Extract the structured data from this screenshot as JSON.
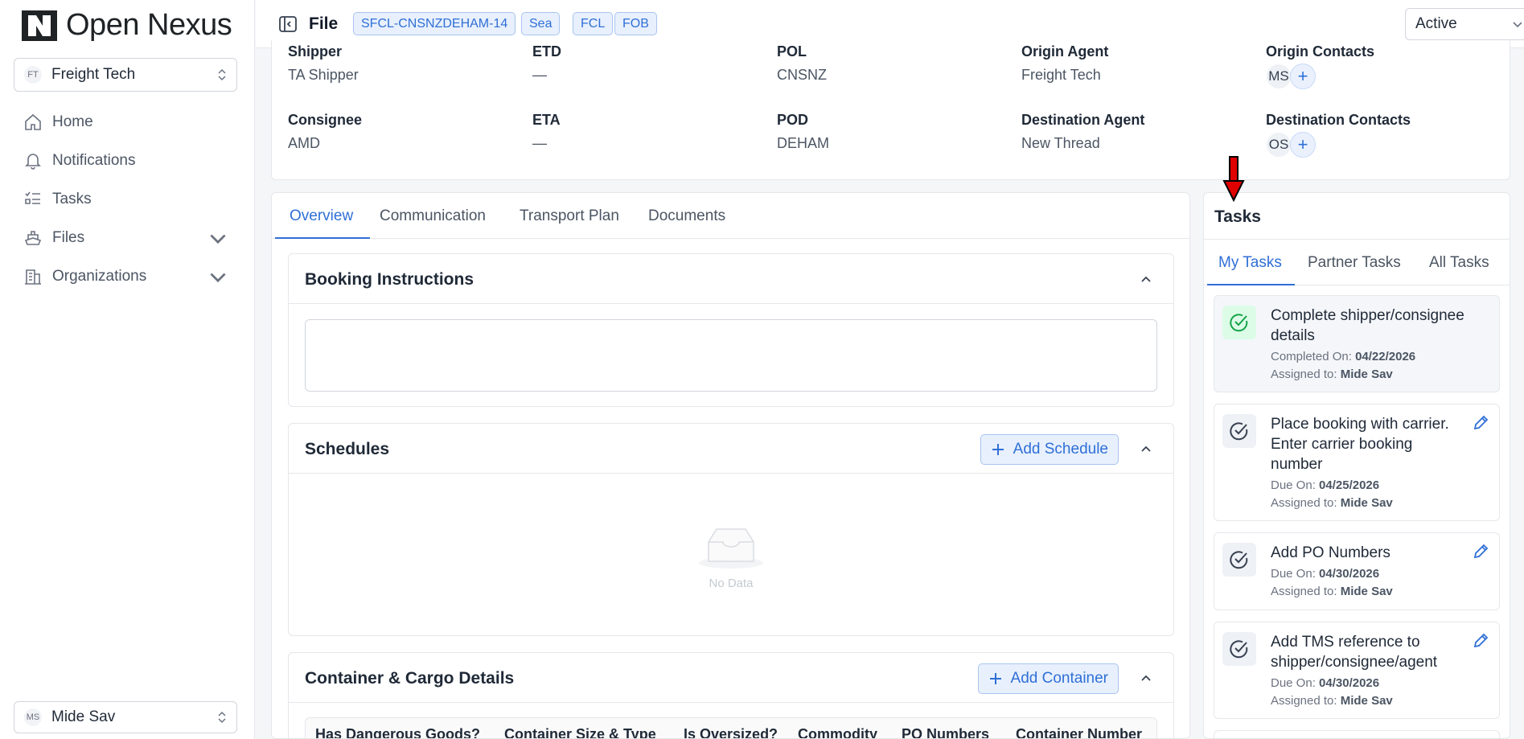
{
  "app": {
    "brand": "Open Nexus"
  },
  "sidebar": {
    "org": {
      "initials": "FT",
      "name": "Freight Tech"
    },
    "items": [
      {
        "label": "Home",
        "icon": "home-icon"
      },
      {
        "label": "Notifications",
        "icon": "bell-icon"
      },
      {
        "label": "Tasks",
        "icon": "tasks-icon"
      },
      {
        "label": "Files",
        "icon": "ship-icon",
        "expandable": true
      },
      {
        "label": "Organizations",
        "icon": "building-icon",
        "expandable": true
      }
    ],
    "user": {
      "initials": "MS",
      "name": "Mide Sav"
    }
  },
  "header": {
    "title": "File",
    "tags": [
      "SFCL-CNSNZDEHAM-14",
      "Sea",
      "FCL",
      "FOB"
    ],
    "status": "Active"
  },
  "summary": {
    "shipper": {
      "label": "Shipper",
      "value": "TA Shipper"
    },
    "etd": {
      "label": "ETD",
      "value": "—"
    },
    "pol": {
      "label": "POL",
      "value": "CNSNZ"
    },
    "origin_agent": {
      "label": "Origin Agent",
      "value": "Freight Tech"
    },
    "origin_contacts": {
      "label": "Origin Contacts",
      "initials": "MS",
      "add": "+"
    },
    "consignee": {
      "label": "Consignee",
      "value": "AMD"
    },
    "eta": {
      "label": "ETA",
      "value": "—"
    },
    "pod": {
      "label": "POD",
      "value": "DEHAM"
    },
    "destination_agent": {
      "label": "Destination Agent",
      "value": "New Thread"
    },
    "destination_contacts": {
      "label": "Destination Contacts",
      "initials": "OS",
      "add": "+"
    }
  },
  "main": {
    "tabs": [
      "Overview",
      "Communication",
      "Transport Plan",
      "Documents"
    ],
    "active_tab": "Overview",
    "booking": {
      "title": "Booking Instructions",
      "value": ""
    },
    "schedules": {
      "title": "Schedules",
      "add_label": "Add Schedule",
      "empty_text": "No Data"
    },
    "containers": {
      "title": "Container & Cargo Details",
      "add_label": "Add Container",
      "columns": [
        "Has Dangerous Goods?",
        "Container Size & Type",
        "Is Oversized?",
        "Commodity",
        "PO Numbers",
        "Container Number"
      ]
    }
  },
  "tasks": {
    "title": "Tasks",
    "tabs": [
      "My Tasks",
      "Partner Tasks",
      "All Tasks"
    ],
    "active_tab": "My Tasks",
    "items": [
      {
        "title": "Complete shipper/consignee details",
        "date_label": "Completed On:",
        "date": "04/22/2026",
        "assignee_label": "Assigned to:",
        "assignee": "Mide Sav",
        "done": true
      },
      {
        "title": "Place booking with carrier. Enter carrier booking number",
        "date_label": "Due On:",
        "date": "04/25/2026",
        "assignee_label": "Assigned to:",
        "assignee": "Mide Sav",
        "done": false
      },
      {
        "title": "Add PO Numbers",
        "date_label": "Due On:",
        "date": "04/30/2026",
        "assignee_label": "Assigned to:",
        "assignee": "Mide Sav",
        "done": false
      },
      {
        "title": "Add TMS reference to shipper/consignee/agent",
        "date_label": "Due On:",
        "date": "04/30/2026",
        "assignee_label": "Assigned to:",
        "assignee": "Mide Sav",
        "done": false
      }
    ]
  },
  "colors": {
    "accent": "#2f6fd6",
    "success": "#16a34a",
    "annotation_arrow": "#e00000"
  }
}
